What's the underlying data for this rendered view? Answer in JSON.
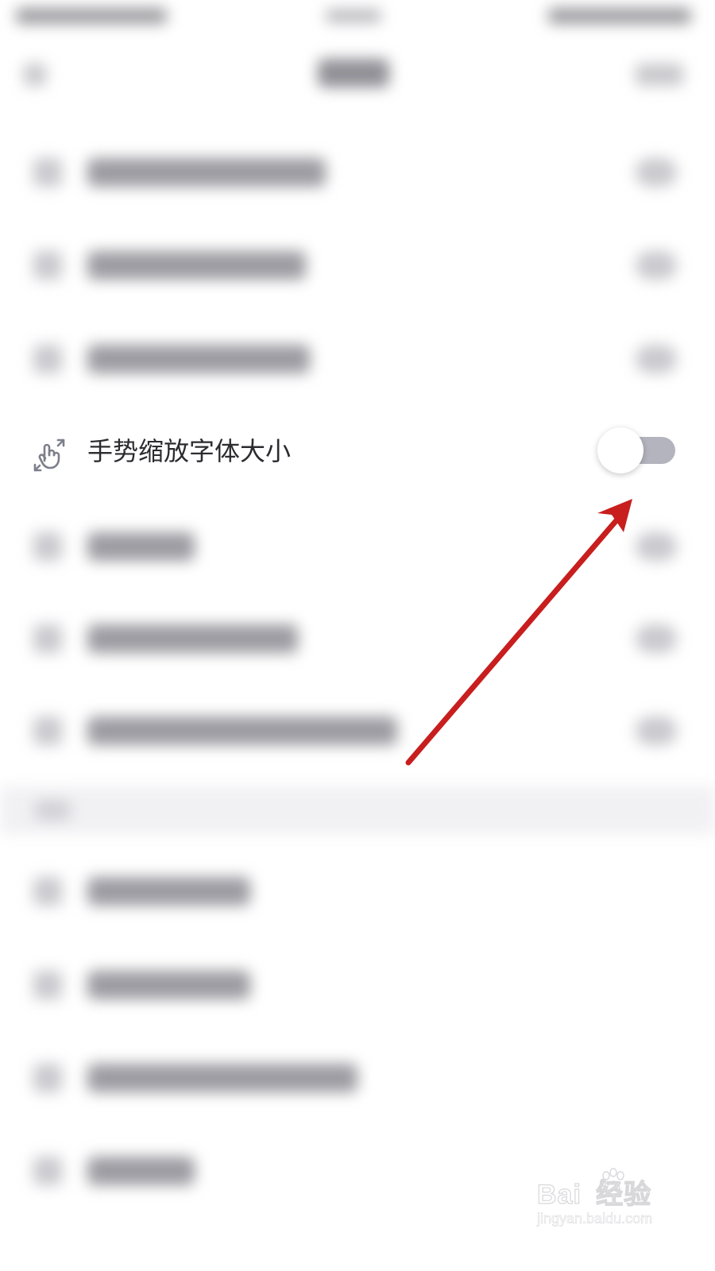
{
  "setting_row": {
    "label": "手势缩放字体大小",
    "icon": "gesture-zoom-icon",
    "toggle_on": false
  },
  "colors": {
    "toggle_track_off": "#b4b4bf",
    "toggle_knob": "#ffffff",
    "label_text": "#2b2b30",
    "icon_gray": "#7d7f8a",
    "annotation_arrow": "#c81e1e"
  },
  "watermark": {
    "logo": "Bai  经验",
    "url": "jingyan.baidu.com"
  }
}
